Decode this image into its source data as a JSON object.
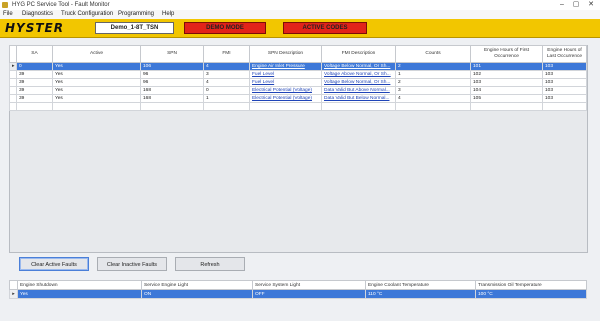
{
  "window": {
    "title": "HYG PC Service Tool - Fault Monitor",
    "minimize": "–",
    "maximize": "▢",
    "close": "✕",
    "accent": "#f2c600"
  },
  "menu": [
    "File",
    "Diagnostics",
    "Truck Configuration",
    "Programming",
    "Help"
  ],
  "banner": {
    "logo": "HYSTER",
    "truck": "Demo_1-8T_TSN",
    "demo_mode": "DEMO MODE",
    "active_codes": "ACTIVE CODES"
  },
  "faults": {
    "headers": [
      "SA",
      "Active",
      "SPN",
      "FMI",
      "SPN Description",
      "FMI Description",
      "Counts",
      "Engine Hours of First Occurrence",
      "Engine Hours of Last Occurrence"
    ],
    "rows": [
      {
        "mark": "▸",
        "sa": "0",
        "active": "Yes",
        "spn": "106",
        "fmi": "4",
        "spn_desc": "Engine Air Inlet Pressure",
        "fmi_desc": "Voltage Below Normal, Or Sh...",
        "counts": "2",
        "first": "101",
        "last": "103",
        "selected": true
      },
      {
        "mark": "",
        "sa": "39",
        "active": "Yes",
        "spn": "96",
        "fmi": "3",
        "spn_desc": "Fuel Level",
        "fmi_desc": "Voltage Above Normal, Or Sh...",
        "counts": "1",
        "first": "102",
        "last": "103",
        "selected": false
      },
      {
        "mark": "",
        "sa": "39",
        "active": "Yes",
        "spn": "96",
        "fmi": "4",
        "spn_desc": "Fuel Level",
        "fmi_desc": "Voltage Below Normal, Or Sh...",
        "counts": "2",
        "first": "103",
        "last": "103",
        "selected": false
      },
      {
        "mark": "",
        "sa": "39",
        "active": "Yes",
        "spn": "168",
        "fmi": "0",
        "spn_desc": "Electrical Potential (Voltage)",
        "fmi_desc": "Data Valid But Above Normal...",
        "counts": "3",
        "first": "104",
        "last": "103",
        "selected": false
      },
      {
        "mark": "",
        "sa": "39",
        "active": "Yes",
        "spn": "168",
        "fmi": "1",
        "spn_desc": "Electrical Potential (Voltage)",
        "fmi_desc": "Data Valid But Below Normal...",
        "counts": "4",
        "first": "105",
        "last": "103",
        "selected": false
      },
      {
        "mark": "",
        "sa": "",
        "active": "",
        "spn": "",
        "fmi": "",
        "spn_desc": "",
        "fmi_desc": "",
        "counts": "",
        "first": "",
        "last": "",
        "selected": false
      }
    ]
  },
  "buttons": {
    "clear_active": "Clear Active Faults",
    "clear_inactive": "Clear Inactive Faults",
    "refresh": "Refresh"
  },
  "status": {
    "headers": [
      "Engine Shutdown",
      "Service Engine Light",
      "Service System Light",
      "Engine Coolant Temperature",
      "Transmission Oil Temperature"
    ],
    "row": {
      "mark": "▸",
      "engine_shutdown": "Yes",
      "service_engine_light": "ON",
      "service_system_light": "OFF",
      "coolant_temp": "110 °C",
      "trans_oil_temp": "100 °C"
    }
  }
}
